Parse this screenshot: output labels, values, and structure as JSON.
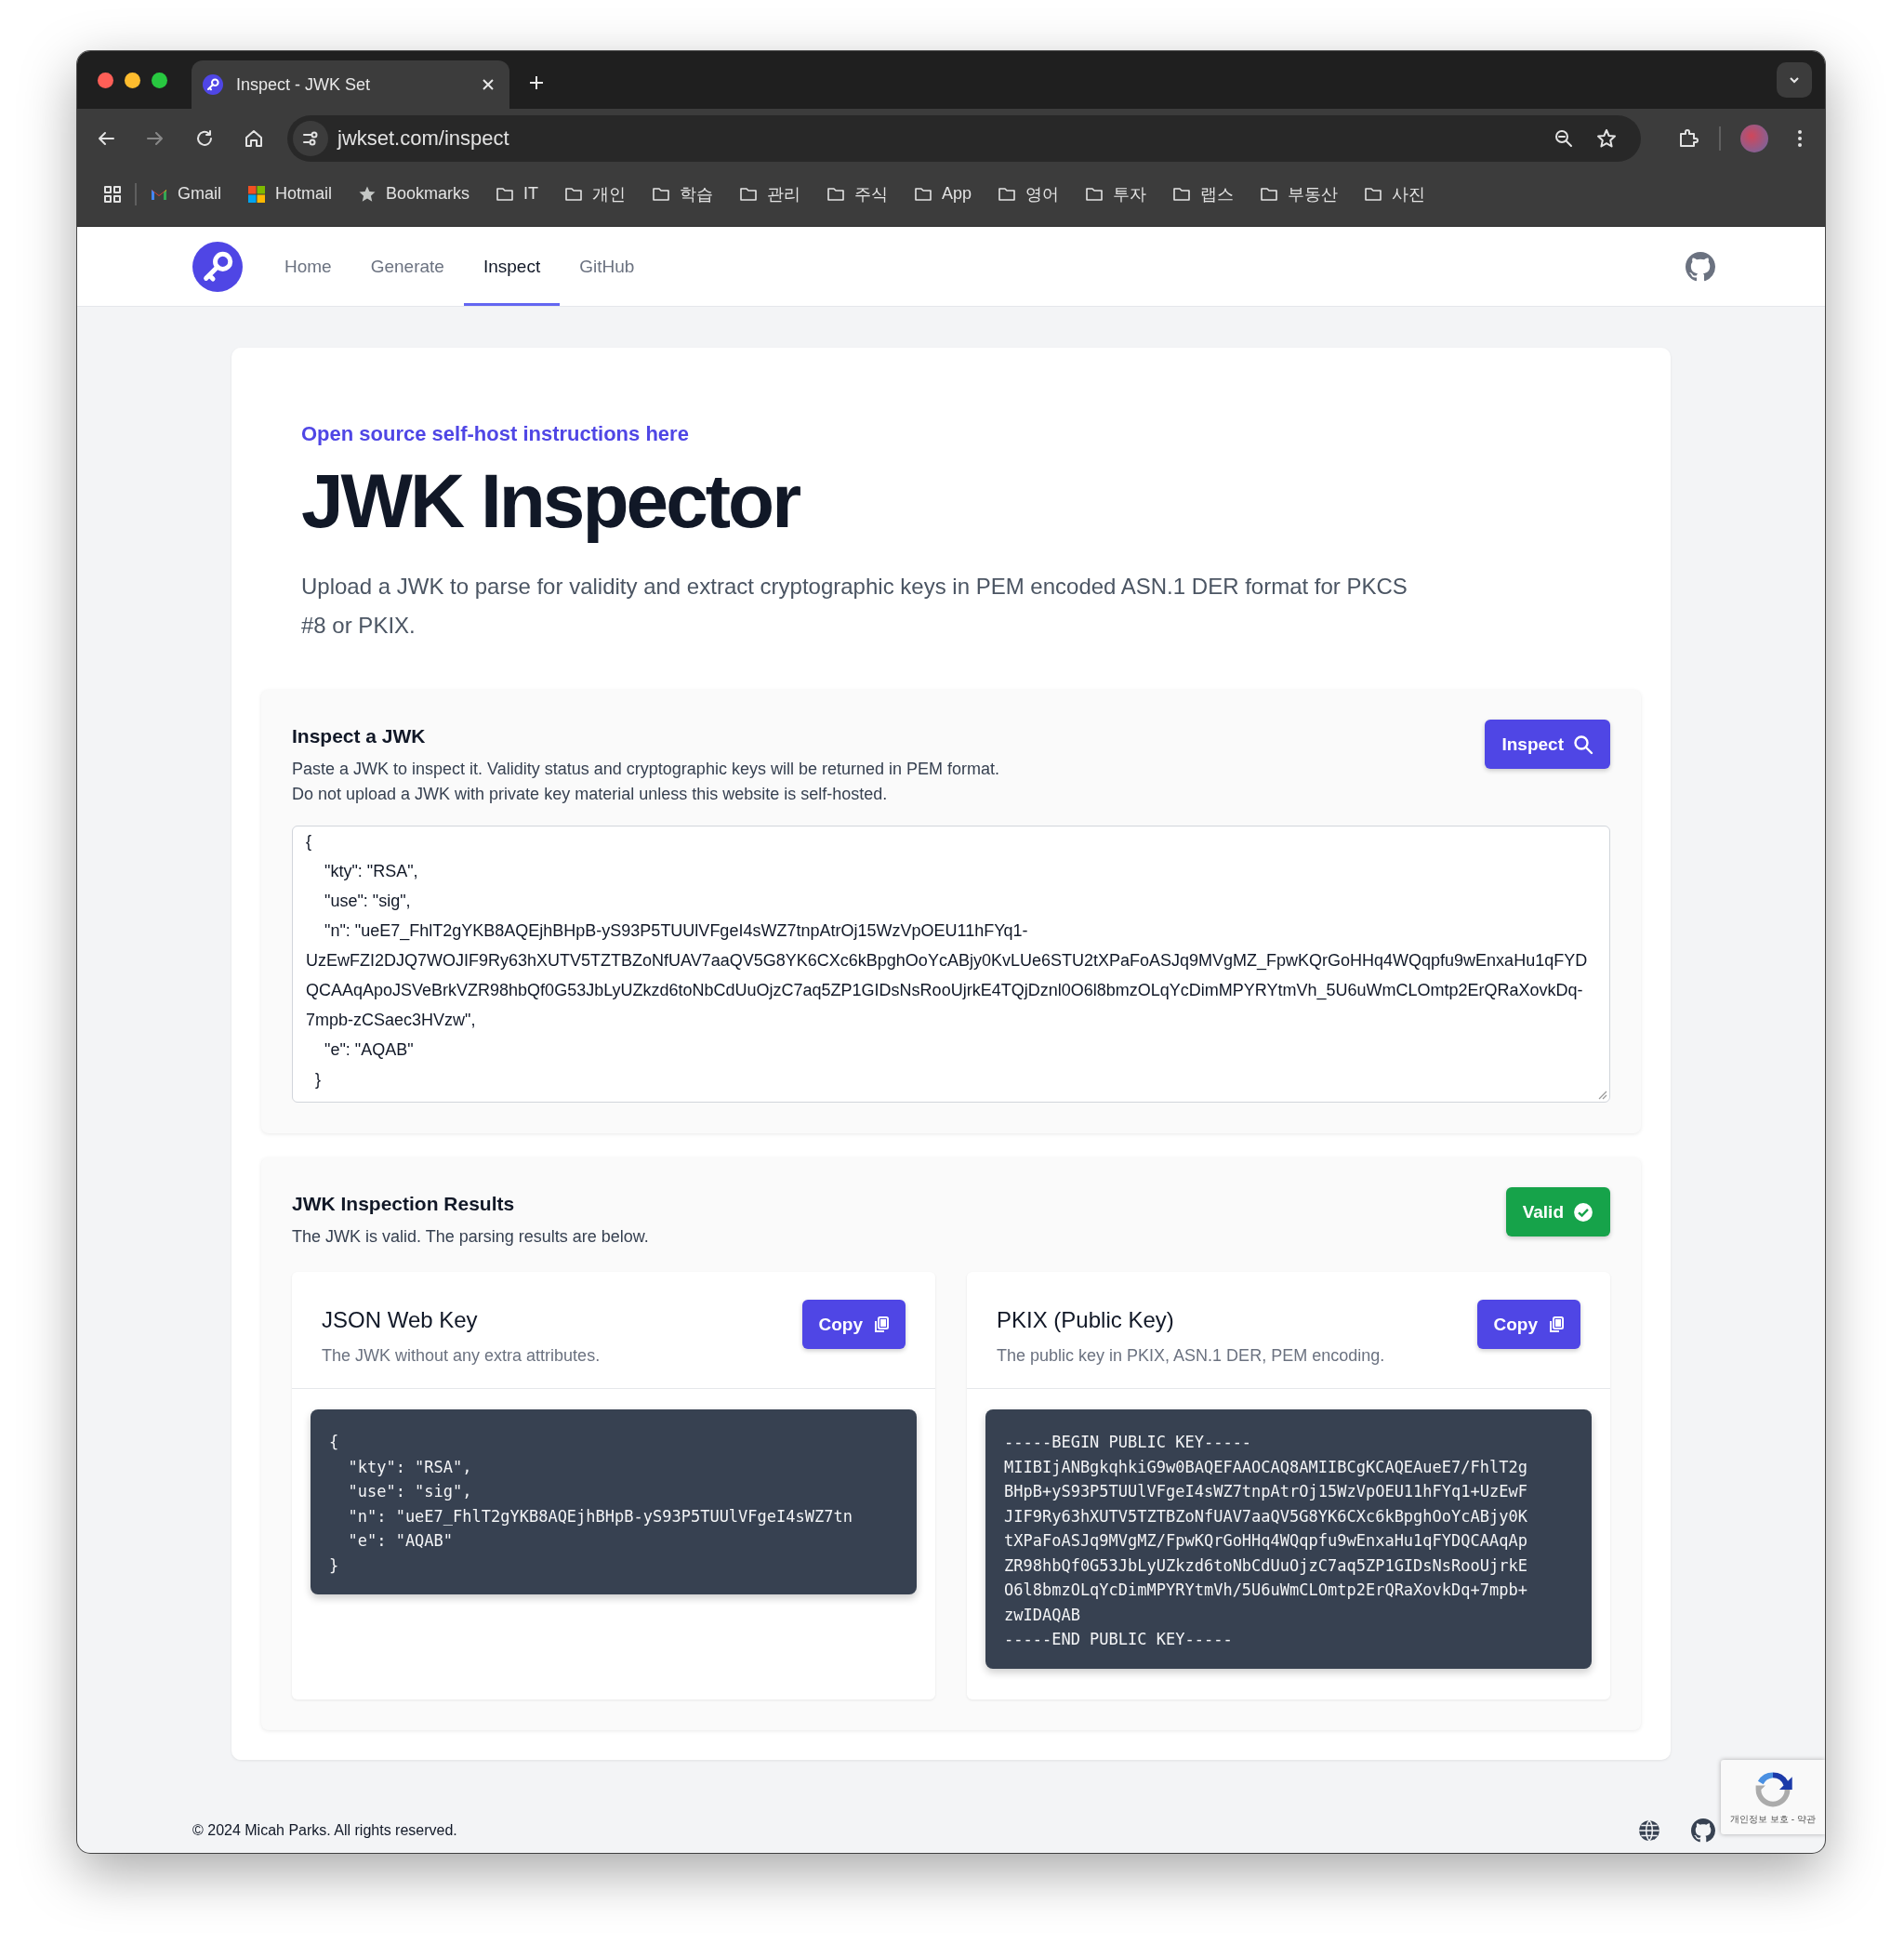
{
  "browser": {
    "tabs": [
      {
        "title": "Inspect - JWK Set",
        "selected": true
      }
    ],
    "url": "jwkset.com/inspect",
    "forward_disabled": true,
    "bookmarks": [
      {
        "label": "Gmail",
        "kind": "gmail"
      },
      {
        "label": "Hotmail",
        "kind": "hotmail"
      },
      {
        "label": "Bookmarks",
        "kind": "star"
      },
      {
        "label": "IT",
        "kind": "folder"
      },
      {
        "label": "개인",
        "kind": "folder"
      },
      {
        "label": "학습",
        "kind": "folder"
      },
      {
        "label": "관리",
        "kind": "folder"
      },
      {
        "label": "주식",
        "kind": "folder"
      },
      {
        "label": "App",
        "kind": "folder"
      },
      {
        "label": "영어",
        "kind": "folder"
      },
      {
        "label": "투자",
        "kind": "folder"
      },
      {
        "label": "랩스",
        "kind": "folder"
      },
      {
        "label": "부동산",
        "kind": "folder"
      },
      {
        "label": "사진",
        "kind": "folder"
      }
    ]
  },
  "nav": {
    "links": [
      {
        "label": "Home",
        "selected": false
      },
      {
        "label": "Generate",
        "selected": false
      },
      {
        "label": "Inspect",
        "selected": true
      },
      {
        "label": "GitHub",
        "selected": false
      }
    ]
  },
  "hero": {
    "link": "Open source self-host instructions here",
    "title": "JWK Inspector",
    "description": "Upload a JWK to parse for validity and extract cryptographic keys in PEM encoded ASN.1 DER format for PKCS #8 or PKIX."
  },
  "inspect_panel": {
    "title": "Inspect a JWK",
    "description": [
      "Paste a JWK to inspect it. Validity status and cryptographic keys will be returned in PEM format.",
      "Do not upload a JWK with private key material unless this website is self-hosted."
    ],
    "button": "Inspect",
    "jwk_input": "{\n    \"kty\": \"RSA\",\n    \"use\": \"sig\",\n    \"n\": \"ueE7_FhlT2gYKB8AQEjhBHpB-yS93P5TUUlVFgeI4sWZ7tnpAtrOj15WzVpOEU11hFYq1-UzEwFZI2DJQ7WOJIF9Ry63hXUTV5TZTBZoNfUAV7aaQV5G8YK6CXc6kBpghOoYcABjy0KvLUe6STU2tXPaFoASJq9MVgMZ_FpwKQrGoHHq4WQqpfu9wEnxaHu1qFYDQCAAqApoJSVeBrkVZR98hbQf0G53JbLyUZkzd6toNbCdUuOjzC7aq5ZP1GIDsNsRooUjrkE4TQjDznl0O6l8bmzOLqYcDimMPYRYtmVh_5U6uWmCLOmtp2ErQRaXovkDq-7mpb-zCSaec3HVzw\",\n    \"e\": \"AQAB\"\n  }"
  },
  "results": {
    "title": "JWK Inspection Results",
    "description": "The JWK is valid. The parsing results are below.",
    "status": {
      "label": "Valid",
      "kind": "valid"
    },
    "cards": [
      {
        "title": "JSON Web Key",
        "subtitle": "The JWK without any extra attributes.",
        "button": "Copy",
        "code": [
          "{",
          "  \"kty\": \"RSA\",",
          "  \"use\": \"sig\",",
          "  \"n\": \"ueE7_FhlT2gYKB8AQEjhBHpB-yS93P5TUUlVFgeI4sWZ7tn",
          "  \"e\": \"AQAB\"",
          "}"
        ]
      },
      {
        "title": "PKIX (Public Key)",
        "subtitle": "The public key in PKIX, ASN.1 DER, PEM encoding.",
        "button": "Copy",
        "code": [
          "-----BEGIN PUBLIC KEY-----",
          "MIIBIjANBgkqhkiG9w0BAQEFAAOCAQ8AMIIBCgKCAQEAueE7/FhlT2g",
          "BHpB+yS93P5TUUlVFgeI4sWZ7tnpAtrOj15WzVpOEU11hFYq1+UzEwF",
          "JIF9Ry63hXUTV5TZTBZoNfUAV7aaQV5G8YK6CXc6kBpghOoYcABjy0K",
          "tXPaFoASJq9MVgMZ/FpwKQrGoHHq4WQqpfu9wEnxaHu1qFYDQCAAqAp",
          "ZR98hbQf0G53JbLyUZkzd6toNbCdUuOjzC7aq5ZP1GIDsNsRooUjrkE",
          "O6l8bmzOLqYcDimMPYRYtmVh/5U6uWmCLOmtp2ErQRaXovkDq+7mpb+",
          "zwIDAQAB",
          "-----END PUBLIC KEY-----"
        ]
      }
    ]
  },
  "footer": {
    "copyright": "© 2024 Micah Parks. All rights reserved."
  },
  "recaptcha": {
    "text": "개인정보 보호 - 약관"
  }
}
